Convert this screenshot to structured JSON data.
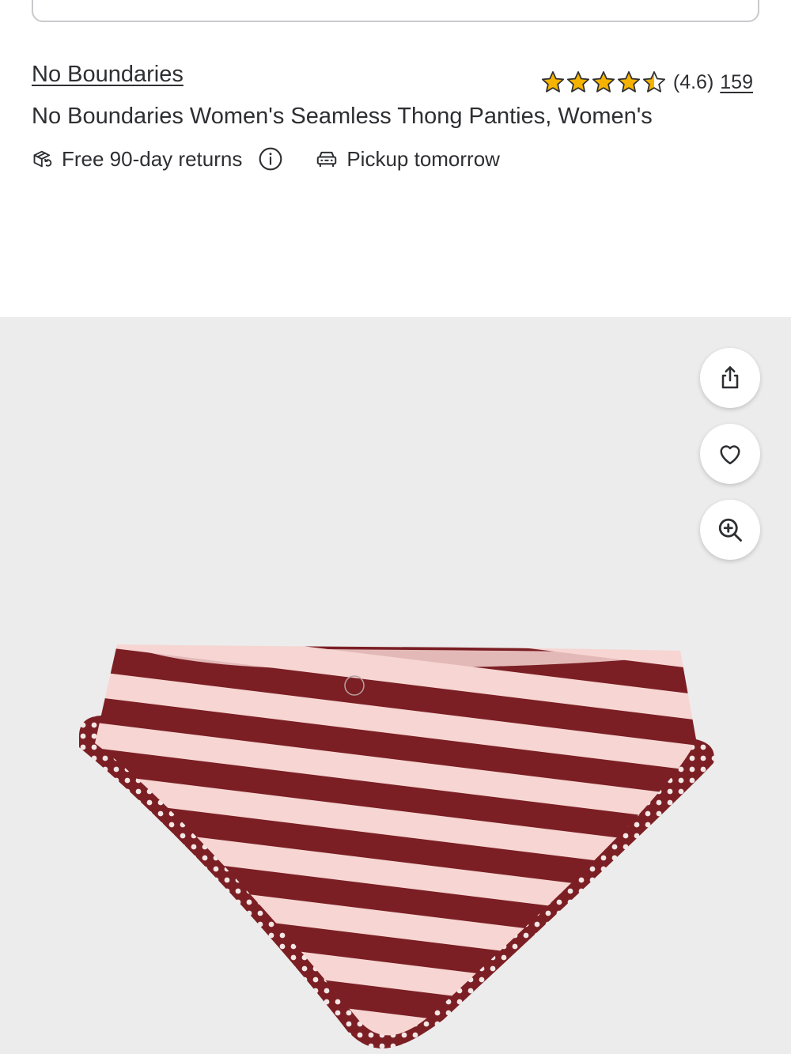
{
  "product": {
    "brand": "No Boundaries",
    "title": "No Boundaries Women's Seamless Thong Panties, Women's",
    "rating_value": "(4.6)",
    "rating_stars": 4.5,
    "review_count": "159"
  },
  "badges": {
    "returns": "Free 90-day returns",
    "pickup": "Pickup tomorrow"
  },
  "gallery": {
    "actions": [
      "share-icon",
      "heart-icon",
      "zoom-in-icon"
    ]
  },
  "colors": {
    "star": "#f5b300",
    "text": "#2e2f32",
    "gallery_bg": "#ececec",
    "stripe_dark": "#7b1f24",
    "stripe_light": "#f6d5d2"
  }
}
